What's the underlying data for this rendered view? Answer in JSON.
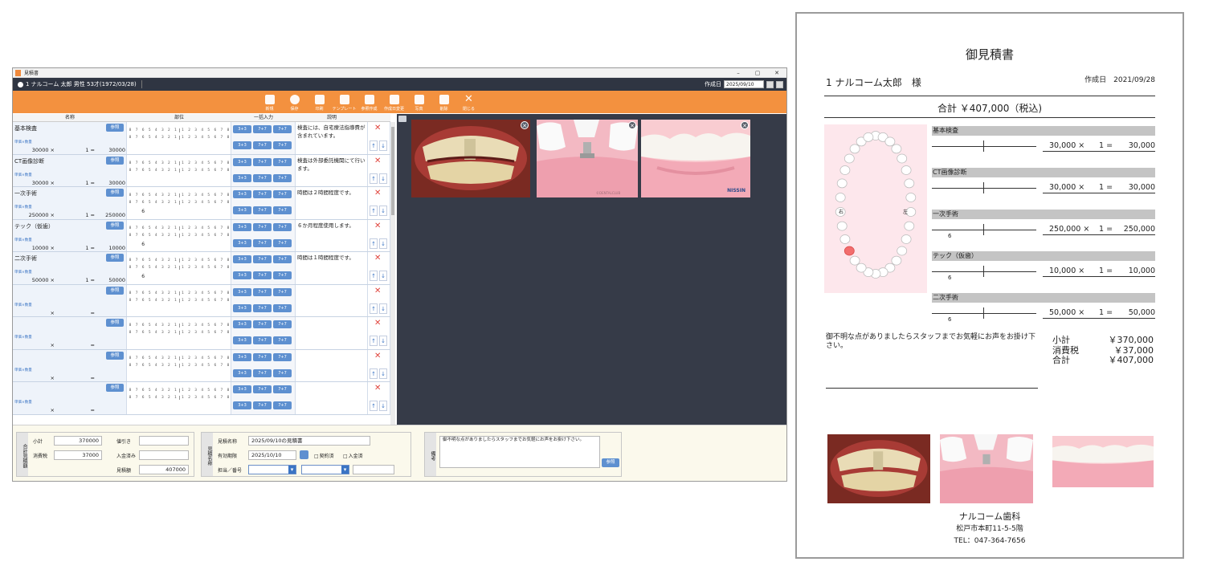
{
  "app": {
    "window_title": "見積書",
    "patient": "1 ナルコーム 太郎 男性 53才(1972/03/28)",
    "created_label": "作成日",
    "created_date": "2025/09/10",
    "toolbar": [
      {
        "name": "new",
        "label": "新規"
      },
      {
        "name": "save",
        "label": "保存"
      },
      {
        "name": "print",
        "label": "印刷"
      },
      {
        "name": "template",
        "label": "テンプレート"
      },
      {
        "name": "reference",
        "label": "参照作成"
      },
      {
        "name": "change-date",
        "label": "作成日変更"
      },
      {
        "name": "photo",
        "label": "写真"
      },
      {
        "name": "delete",
        "label": "削除"
      },
      {
        "name": "close",
        "label": "閉じる"
      }
    ],
    "columns": {
      "name": "名称",
      "site": "部位",
      "bulk": "一括入力",
      "desc": "説明"
    },
    "ref_label": "参照",
    "sub_label": "単価×数量",
    "times": "×",
    "equals": "=",
    "bulk_buttons": [
      "3+3",
      "7+7",
      "7+7"
    ],
    "teeth_left": [
      "8",
      "7",
      "6",
      "5",
      "4",
      "3",
      "2",
      "1"
    ],
    "teeth_right": [
      "1",
      "2",
      "3",
      "4",
      "5",
      "6",
      "7",
      "8"
    ],
    "rows": [
      {
        "name": "基本検査",
        "price": "30000",
        "qty": "1",
        "total": "30000",
        "tooth": "",
        "desc": "検査には、自宅療法指導費が含まれています。"
      },
      {
        "name": "CT画像診断",
        "price": "30000",
        "qty": "1",
        "total": "30000",
        "tooth": "",
        "desc": "検査は外部委託機関にて行います。"
      },
      {
        "name": "一次手術",
        "price": "250000",
        "qty": "1",
        "total": "250000",
        "tooth": "6",
        "desc": "時間は２時間程度です。"
      },
      {
        "name": "テック（仮歯）",
        "price": "10000",
        "qty": "1",
        "total": "10000",
        "tooth": "6",
        "desc": "６か月程度使用します。"
      },
      {
        "name": "二次手術",
        "price": "50000",
        "qty": "1",
        "total": "50000",
        "tooth": "6",
        "desc": "時間は１時間程度です。"
      },
      {
        "name": "",
        "price": "",
        "qty": "",
        "total": "",
        "tooth": "",
        "desc": ""
      },
      {
        "name": "",
        "price": "",
        "qty": "",
        "total": "",
        "tooth": "",
        "desc": ""
      },
      {
        "name": "",
        "price": "",
        "qty": "",
        "total": "",
        "tooth": "",
        "desc": ""
      },
      {
        "name": "",
        "price": "",
        "qty": "",
        "total": "",
        "tooth": "",
        "desc": ""
      }
    ],
    "totals": {
      "group_label": "合計見積額",
      "subtotal_label": "小計",
      "subtotal": "370000",
      "tax_label": "消費税",
      "tax": "37000",
      "discount_label": "値引き",
      "discount": "",
      "paid_label": "入金済み",
      "paid": "",
      "amount_label": "見積額",
      "amount": "407000"
    },
    "estimate": {
      "group_label": "見積名称",
      "name_label": "見積名称",
      "name": "2025/09/10の見積書",
      "valid_label": "有効期限",
      "valid": "2025/10/10",
      "contract_label": "契約済",
      "deposit_label": "入金済",
      "staff_label": "担当／番号"
    },
    "remarks": {
      "group_label": "備考",
      "text": "御不明な点がありましたらスタッフまでお気軽にお声をお掛け下さい。",
      "ref_label": "参照"
    },
    "photo_watermark": "NISSIN",
    "photo_caption": "©DENTALCLUB"
  },
  "doc": {
    "title": "御見積書",
    "patient": "1 ナルコーム太郎　様",
    "date_label": "作成日",
    "date": "2021/09/28",
    "total_line": "合計 ￥407,000（税込)",
    "chart_right": "右",
    "chart_left": "左",
    "items": [
      {
        "name": "基本検査",
        "price": "30,000",
        "qty": "1",
        "total": "30,000",
        "tooth": ""
      },
      {
        "name": "CT画像診断",
        "price": "30,000",
        "qty": "1",
        "total": "30,000",
        "tooth": ""
      },
      {
        "name": "一次手術",
        "price": "250,000",
        "qty": "1",
        "total": "250,000",
        "tooth": "6"
      },
      {
        "name": "テック（仮歯）",
        "price": "10,000",
        "qty": "1",
        "total": "10,000",
        "tooth": "6"
      },
      {
        "name": "二次手術",
        "price": "50,000",
        "qty": "1",
        "total": "50,000",
        "tooth": "6"
      }
    ],
    "times": "×",
    "equals": "=",
    "note": "御不明な点がありましたらスタッフまでお気軽にお声をお掛け下さい。",
    "subtotal_label": "小計",
    "subtotal": "￥370,000",
    "tax_label": "消費税",
    "tax": "￥37,000",
    "sum_label": "合計",
    "sum": "￥407,000",
    "clinic_name": "ナルコーム歯科",
    "clinic_address": "松戸市本町11-5-5階",
    "clinic_tel": "TEL：047-364-7656"
  },
  "colors": {
    "accent": "#f3913f",
    "dark": "#2f3542",
    "button": "#5e90d0",
    "delete": "#e0433b"
  }
}
